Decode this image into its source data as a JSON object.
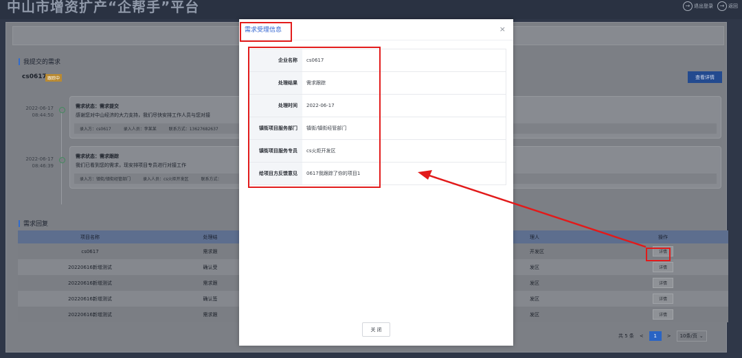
{
  "app": {
    "title": "中山市增资扩产“企帮手”平台"
  },
  "top_actions": [
    {
      "label": "退出登录",
      "icon": "logout-icon"
    },
    {
      "label": "返回",
      "icon": "back-icon"
    }
  ],
  "my_demands": {
    "section_title": "我提交的需求",
    "demand_name": "cs0617",
    "demand_tag": "跟踪中",
    "view_detail_label": "查看详情",
    "timeline": [
      {
        "date": "2022-06-17",
        "time": "08:44:50",
        "status": "需求状态：需求提交",
        "desc": "感谢您对中山经济的大力支持，我们尽快安排工作人员与您对接",
        "meta": [
          "录入方：cs0617",
          "录入人员：李某某",
          "联系方式：13627682637"
        ]
      },
      {
        "date": "2022-06-17",
        "time": "08:46:39",
        "status": "需求状态：需求跟踪",
        "desc": "我们已看到您的需求，现安排项目专员进行对接工作",
        "meta": [
          "录入方：镇街/镇街经管部门",
          "录入人员：cs火炬开发区",
          "联系方式："
        ]
      }
    ]
  },
  "replies": {
    "section_title": "需求回复",
    "headers": {
      "name": "项目名称",
      "result": "处理结",
      "person": "理人",
      "op": "操作"
    },
    "rows": [
      {
        "name": "cs0617",
        "result": "需求跟",
        "person": "开发区",
        "op": "详情"
      },
      {
        "name": "20220616新增测试",
        "result": "确认受",
        "person": "发区",
        "op": "详情"
      },
      {
        "name": "20220616新增测试",
        "result": "需求跟",
        "person": "发区",
        "op": "详情"
      },
      {
        "name": "20220616新增测试",
        "result": "确认签",
        "person": "发区",
        "op": "详情"
      },
      {
        "name": "20220616新增测试",
        "result": "需求跟",
        "person": "发区",
        "op": "详情"
      }
    ]
  },
  "pagination": {
    "total": "共 5 条",
    "current": "1",
    "page_size": "10条/页",
    "prev": "<",
    "next": ">"
  },
  "modal": {
    "title": "需求受理信息",
    "close_icon": "×",
    "footer_button": "关 闭",
    "rows": [
      {
        "label": "企业名称",
        "value": "cs0617"
      },
      {
        "label": "处理结果",
        "value": "需求跟踪"
      },
      {
        "label": "处理时间",
        "value": "2022-06-17"
      },
      {
        "label": "镇街项目服务部门",
        "value": "镇街/镇街经管部门"
      },
      {
        "label": "镇街项目服务专员",
        "value": "cs火炬开发区"
      },
      {
        "label": "给项目方反馈意见",
        "value": "0617我跟踪了你的项目1"
      }
    ]
  },
  "colors": {
    "accent": "#2f63d0",
    "highlight": "#e21a1a",
    "overlay": "#7c7f85"
  }
}
